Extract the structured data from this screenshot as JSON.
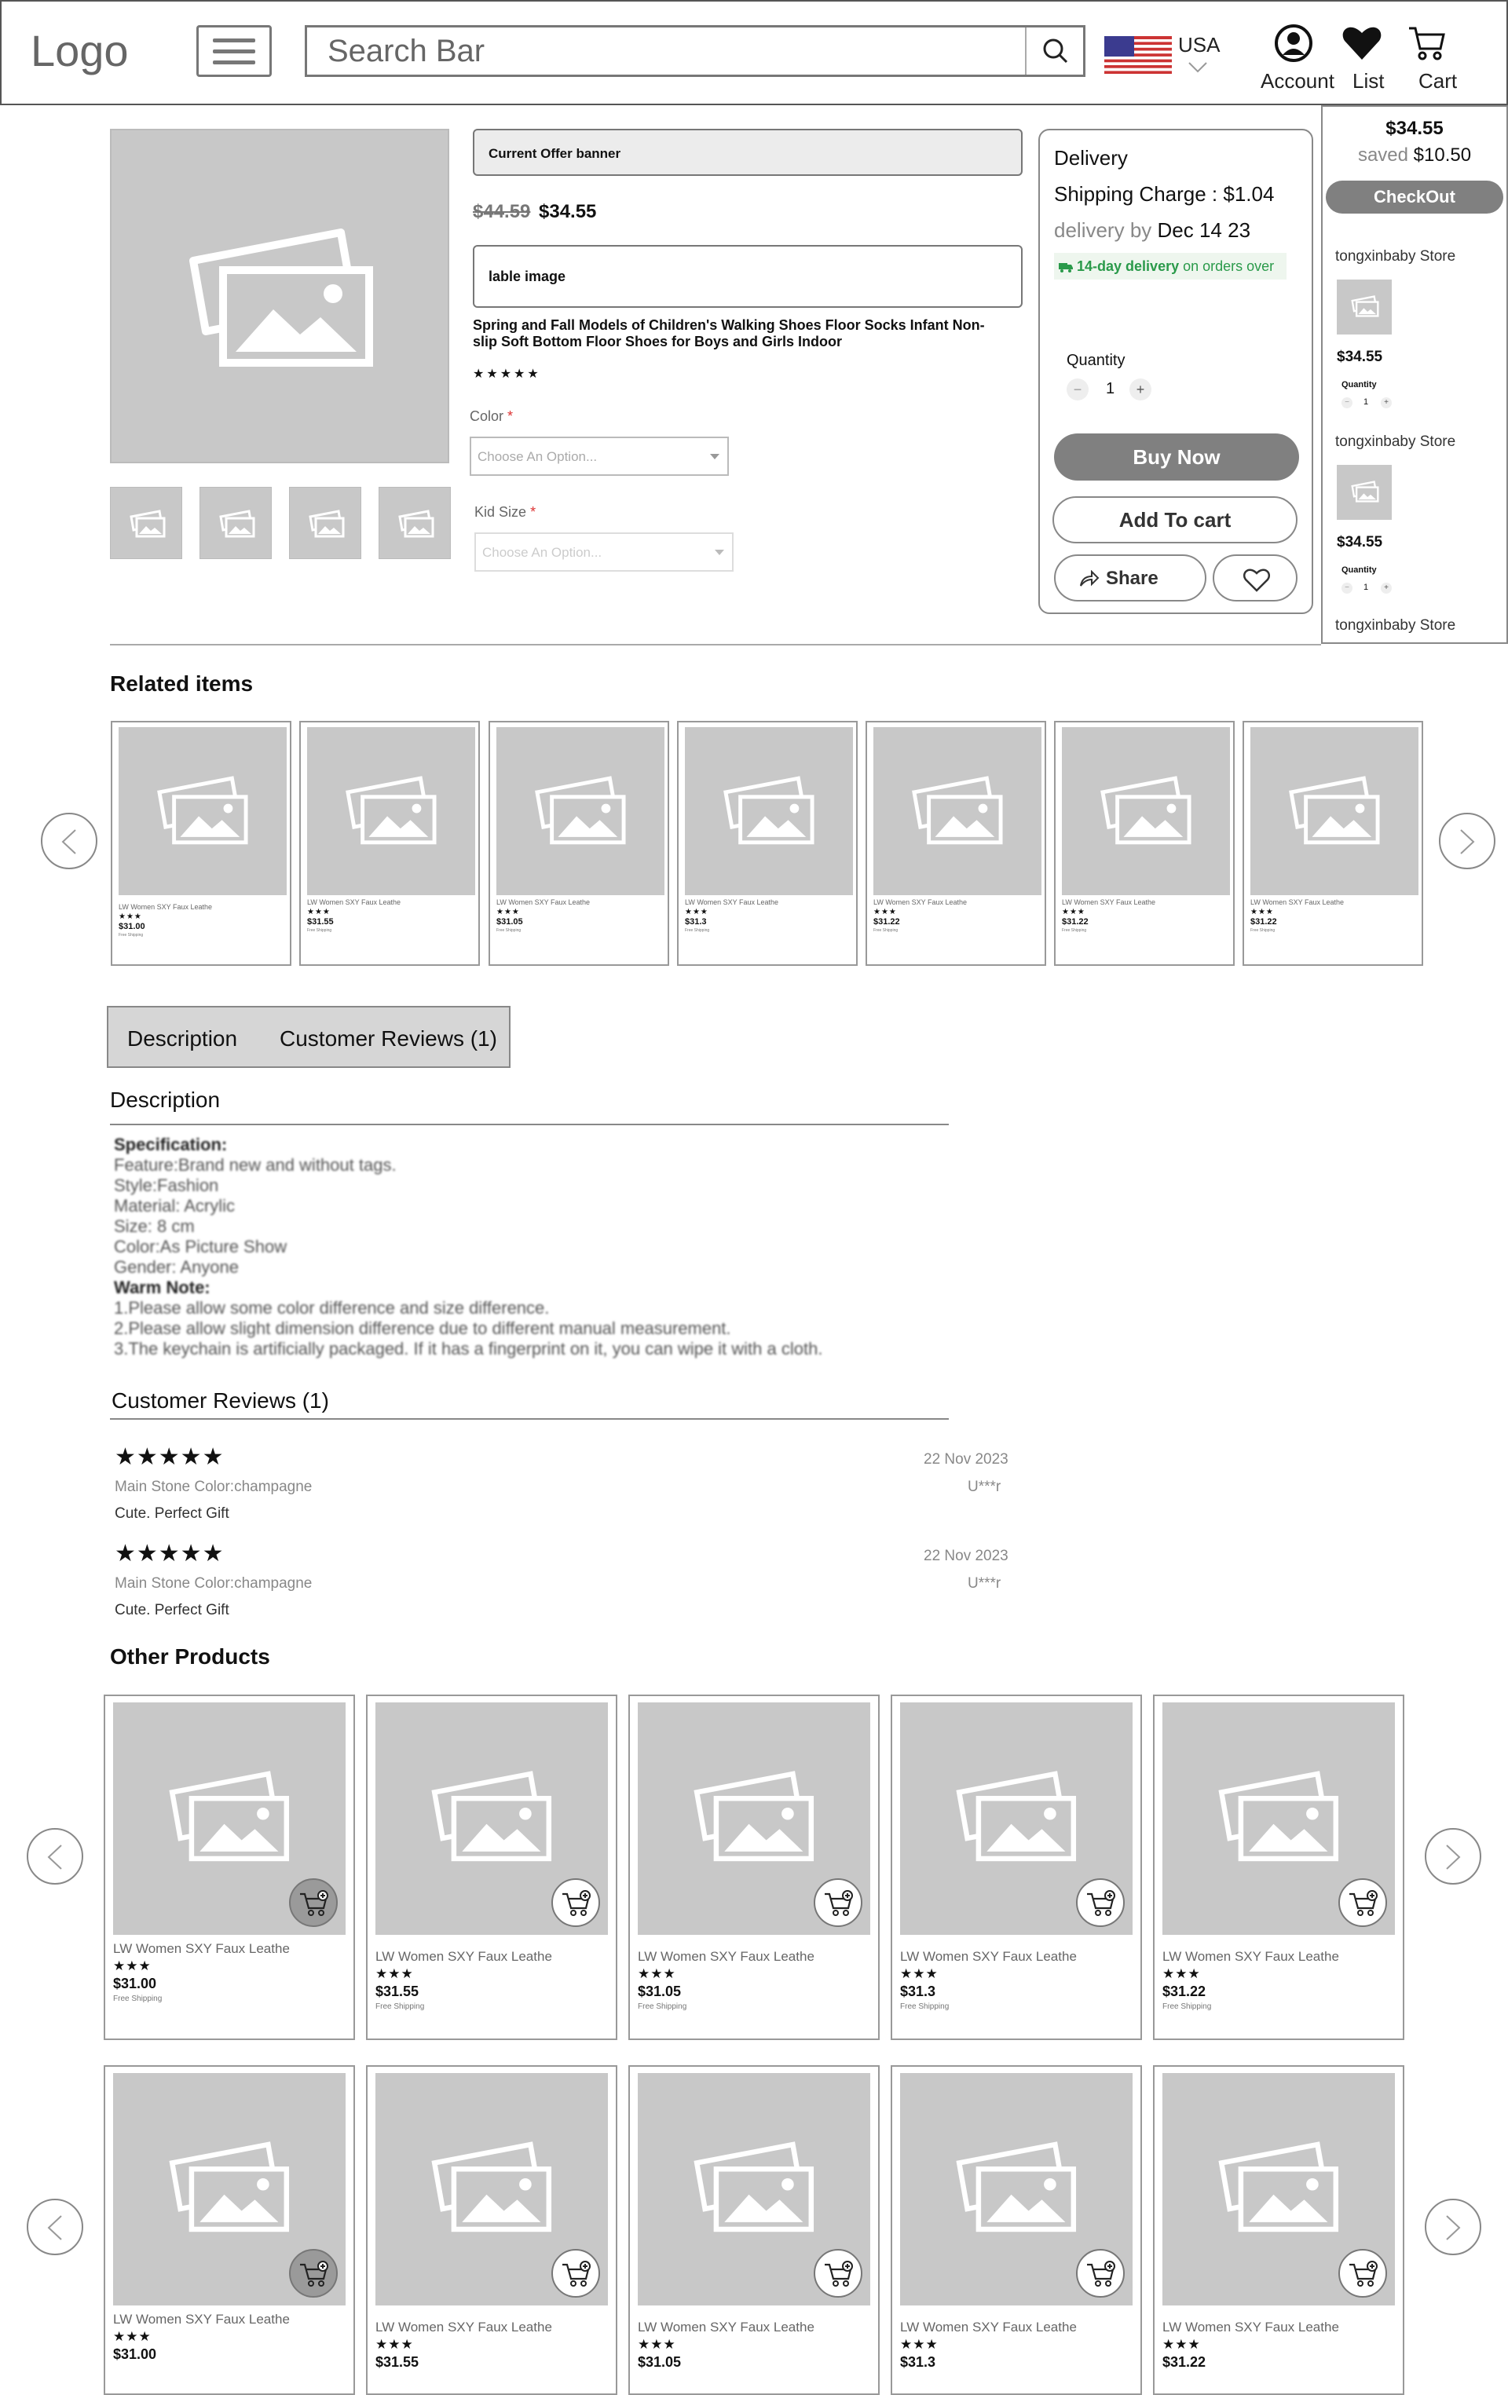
{
  "header": {
    "logo": "Logo",
    "search_placeholder": "Search Bar",
    "country": "USA",
    "account_label": "Account",
    "list_label": "List",
    "cart_label": "Cart"
  },
  "product": {
    "offer_banner": "Current Offer banner",
    "old_price": "$44.59",
    "price": "$34.55",
    "lable_image": "lable image",
    "title_line1": "Spring and Fall Models of Children's Walking Shoes Floor Socks Infant Non-",
    "title_line2": "slip Soft Bottom Floor Shoes for Boys and Girls Indoor",
    "stars": "★★★★★",
    "color_label": "Color",
    "color_placeholder": "Choose An Option...",
    "kid_size_label": "Kid Size",
    "kid_size_placeholder": "Choose An Option...",
    "required_mark": "*"
  },
  "delivery": {
    "title": "Delivery",
    "shipping_charge": "Shipping Charge : $1.04",
    "delivery_by_label": "delivery by",
    "delivery_date": "Dec 14 23",
    "badge_strong": "14-day delivery",
    "badge_rest": "on orders over",
    "quantity_label": "Quantity",
    "quantity_value": "1",
    "buy_now": "Buy Now",
    "add_to_cart": "Add To cart",
    "share": "Share"
  },
  "side_cart": {
    "total": "$34.55",
    "saved_label": "saved",
    "saved_value": "$10.50",
    "checkout": "CheckOut",
    "stores": [
      {
        "name": "tongxinbaby Store",
        "price": "$34.55",
        "qty_label": "Quantity",
        "qty": "1"
      },
      {
        "name": "tongxinbaby Store",
        "price": "$34.55",
        "qty_label": "Quantity",
        "qty": "1"
      },
      {
        "name": "tongxinbaby Store"
      }
    ]
  },
  "related": {
    "title": "Related items",
    "items": [
      {
        "name": "LW Women SXY Faux Leathe",
        "stars": "★★★",
        "price": "$31.00",
        "shipping": "Free Shipping"
      },
      {
        "name": "LW Women SXY Faux Leathe",
        "stars": "★★★",
        "price": "$31.55",
        "shipping": "Free Shipping"
      },
      {
        "name": "LW Women SXY Faux Leathe",
        "stars": "★★★",
        "price": "$31.05",
        "shipping": "Free Shipping"
      },
      {
        "name": "LW Women SXY Faux Leathe",
        "stars": "★★★",
        "price": "$31.3",
        "shipping": "Free Shipping"
      },
      {
        "name": "LW Women SXY Faux Leathe",
        "stars": "★★★",
        "price": "$31.22",
        "shipping": "Free Shipping"
      },
      {
        "name": "LW Women SXY Faux Leathe",
        "stars": "★★★",
        "price": "$31.22",
        "shipping": "Free Shipping"
      },
      {
        "name": "LW Women SXY Faux Leathe",
        "stars": "★★★",
        "price": "$31.22",
        "shipping": "Free Shipping"
      }
    ]
  },
  "tabs": {
    "description": "Description",
    "reviews": "Customer Reviews (1)"
  },
  "description": {
    "title": "Description",
    "lines": [
      "Specification:",
      "Feature:Brand new and without tags.",
      "Style:Fashion",
      "Material: Acrylic",
      "Size: 8 cm",
      "Color:As Picture Show",
      "Gender: Anyone",
      "Warm Note:",
      "1.Please allow some color difference and size difference.",
      "2.Please allow slight dimension difference due to different manual measurement.",
      "3.The keychain is artificially packaged. If it has a fingerprint on it, you can wipe it with a cloth."
    ]
  },
  "reviews": {
    "title": "Customer Reviews (1)",
    "items": [
      {
        "stars": "★★★★★",
        "date": "22 Nov 2023",
        "meta": "Main Stone Color:champagne",
        "user": "U***r",
        "text": "Cute. Perfect Gift"
      },
      {
        "stars": "★★★★★",
        "date": "22 Nov 2023",
        "meta": "Main Stone Color:champagne",
        "user": "U***r",
        "text": "Cute. Perfect Gift"
      }
    ]
  },
  "other": {
    "title": "Other Products",
    "row1": [
      {
        "name": "LW Women SXY Faux Leathe",
        "stars": "★★★",
        "price": "$31.00",
        "shipping": "Free Shipping"
      },
      {
        "name": "LW Women SXY Faux Leathe",
        "stars": "★★★",
        "price": "$31.55",
        "shipping": "Free Shipping"
      },
      {
        "name": "LW Women SXY Faux Leathe",
        "stars": "★★★",
        "price": "$31.05",
        "shipping": "Free Shipping"
      },
      {
        "name": "LW Women SXY Faux Leathe",
        "stars": "★★★",
        "price": "$31.3",
        "shipping": "Free Shipping"
      },
      {
        "name": "LW Women SXY Faux Leathe",
        "stars": "★★★",
        "price": "$31.22",
        "shipping": "Free Shipping"
      }
    ],
    "row2": [
      {
        "name": "LW Women SXY Faux Leathe",
        "stars": "★★★",
        "price": "$31.00"
      },
      {
        "name": "LW Women SXY Faux Leathe",
        "stars": "★★★",
        "price": "$31.55"
      },
      {
        "name": "LW Women SXY Faux Leathe",
        "stars": "★★★",
        "price": "$31.05"
      },
      {
        "name": "LW Women SXY Faux Leathe",
        "stars": "★★★",
        "price": "$31.3"
      },
      {
        "name": "LW Women SXY Faux Leathe",
        "stars": "★★★",
        "price": "$31.22"
      }
    ]
  }
}
